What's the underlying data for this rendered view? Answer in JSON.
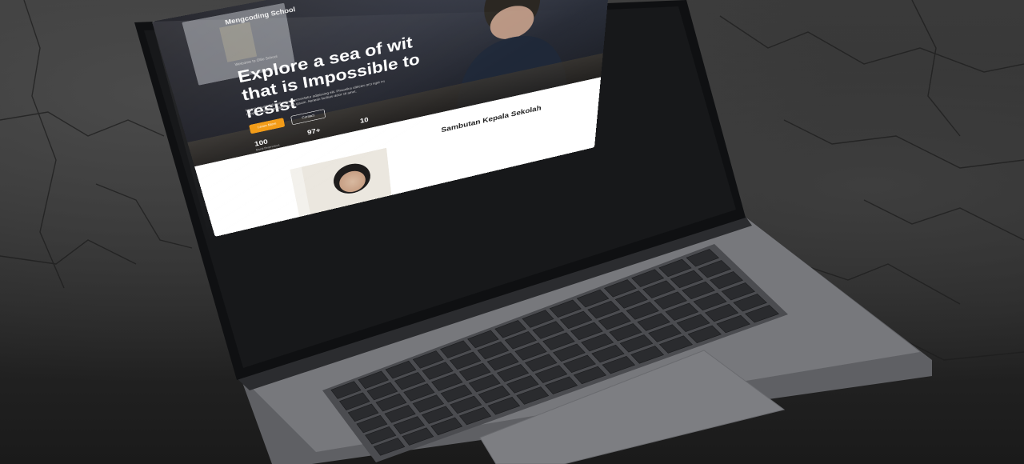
{
  "site": {
    "brand": "Mengcoding School",
    "eyebrow": "Welcome to Ollio School",
    "headline": "Explore a sea of wit that is Impossible to resist",
    "description": "Lorem ipsum dolor sit amet, consectetur adipiscing elit. Phasellus ultricies orci eget mi tempor. Nullam pretium lorem ipsum. Aenean facilisis dolor sit amet.",
    "primary_button": "Learn More",
    "secondary_button": "Contact",
    "stats": [
      "100",
      "97+",
      "10"
    ],
    "stat_caption": "Murid Berprestasi",
    "section_title": "Sambutan Kepala Sekolah"
  },
  "colors": {
    "accent": "#f39a12",
    "hero_overlay": "#14141a",
    "laptop_body": "#6e6f73",
    "keyboard": "#2a2b2e",
    "background": "#2f2f2f"
  }
}
